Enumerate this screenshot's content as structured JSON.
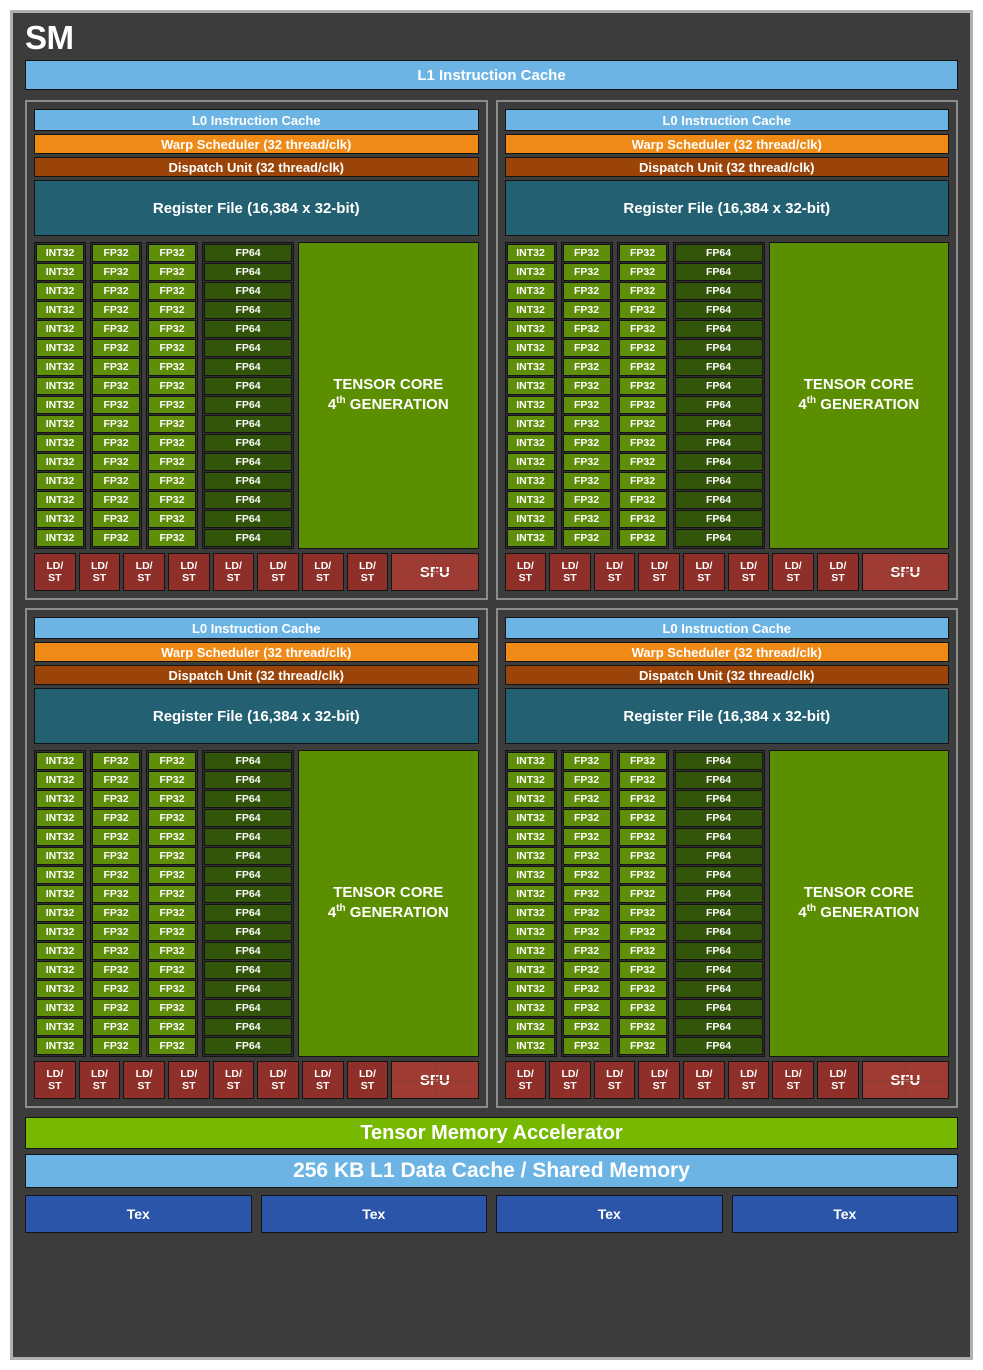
{
  "diagram": {
    "title": "SM",
    "l1_instruction_cache": "L1 Instruction Cache",
    "processing_block": {
      "l0_instruction_cache": "L0 Instruction Cache",
      "warp_scheduler": "Warp Scheduler (32 thread/clk)",
      "dispatch_unit": "Dispatch Unit (32 thread/clk)",
      "register_file": "Register File (16,384 x 32-bit)",
      "core_rows": 16,
      "core_columns": [
        {
          "label": "INT32",
          "count": 16,
          "type": "int32"
        },
        {
          "label": "FP32",
          "count": 16,
          "type": "fp32"
        },
        {
          "label": "FP32",
          "count": 16,
          "type": "fp32"
        },
        {
          "label": "FP64",
          "count": 16,
          "type": "fp64"
        }
      ],
      "tensor_core_line1": "TENSOR CORE",
      "tensor_core_line2_prefix": "4",
      "tensor_core_line2_sup": "th",
      "tensor_core_line2_suffix": " GENERATION",
      "ldst_label_line1": "LD/",
      "ldst_label_line2": "ST",
      "ldst_count": 8,
      "sfu_label": "SFU"
    },
    "processing_block_count": 4,
    "tensor_memory_accelerator": "Tensor Memory Accelerator",
    "l1_data_cache": "256 KB L1 Data Cache / Shared Memory",
    "tex_label": "Tex",
    "tex_count": 4,
    "colors": {
      "frame_background": "#3c3c3c",
      "frame_border": "#b0b0b0",
      "cache_blue": "#6cb4e4",
      "warp_orange": "#ef8a16",
      "dispatch_brown": "#9b4409",
      "register_teal": "#236072",
      "int_fp32_green": "#5f8e0a",
      "fp64_green": "#32550a",
      "tensor_core_green": "#5c8f00",
      "ldst_red": "#8e3029",
      "sfu_red": "#9e3b33",
      "tma_green": "#76b900",
      "tex_blue": "#2a55a8"
    }
  }
}
